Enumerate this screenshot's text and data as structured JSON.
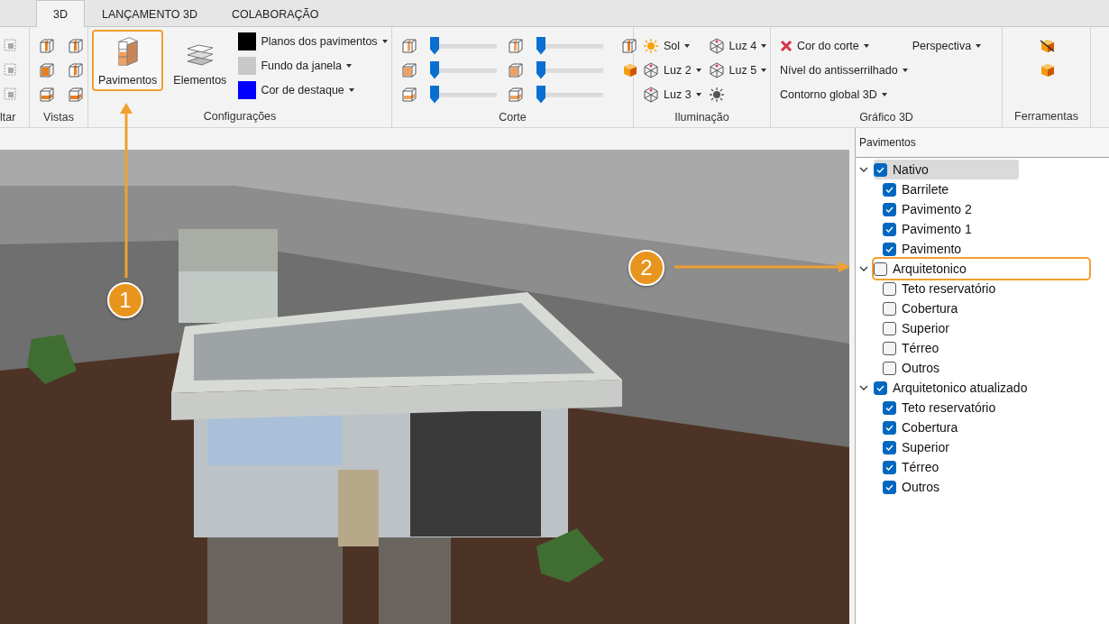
{
  "tabs": [
    {
      "label": "3D",
      "selected": true
    },
    {
      "label": "LANÇAMENTO 3D",
      "selected": false
    },
    {
      "label": "COLABORAÇÃO",
      "selected": false
    }
  ],
  "ribbon": {
    "groups": [
      {
        "kind": "filter",
        "label": "ltar"
      },
      {
        "kind": "views",
        "label": "Vistas"
      },
      {
        "kind": "config",
        "label": "Configurações",
        "big_buttons": [
          {
            "label": "Pavimentos",
            "highlighted": true
          },
          {
            "label": "Elementos",
            "highlighted": false
          }
        ],
        "color_items": [
          {
            "label": "Planos dos pavimentos",
            "color": "#000000"
          },
          {
            "label": "Fundo da janela",
            "color": "#c8c8c8"
          },
          {
            "label": "Cor de destaque",
            "color": "#0000ff"
          }
        ]
      },
      {
        "kind": "cut",
        "label": "Corte",
        "sliders": [
          {
            "level": 0
          },
          {
            "level": 0
          },
          {
            "level": 0
          },
          {
            "level": 0
          },
          {
            "level": 0
          },
          {
            "level": 0
          }
        ]
      },
      {
        "kind": "lights",
        "label": "Iluminação",
        "items": [
          {
            "kind": "sun",
            "label": "Sol"
          },
          {
            "kind": "light",
            "label": "Luz 4"
          },
          {
            "kind": "light",
            "label": "Luz 2"
          },
          {
            "kind": "light",
            "label": "Luz 5"
          },
          {
            "kind": "light",
            "label": "Luz 3"
          }
        ]
      },
      {
        "kind": "graphics",
        "label": "Gráfico 3D",
        "items": [
          {
            "kind": "icon",
            "label": "Cor do corte"
          },
          {
            "kind": "plain",
            "label": "Perspectiva"
          },
          {
            "kind": "wide",
            "label": "Nível do antisserrilhado"
          },
          {
            "kind": "wide",
            "label": "Contorno global 3D"
          }
        ]
      },
      {
        "kind": "tools",
        "label": "Ferramentas"
      }
    ]
  },
  "callouts": [
    {
      "number": "1"
    },
    {
      "number": "2"
    }
  ],
  "panel": {
    "title": "Pavimentos",
    "tree": [
      {
        "label": "Nativo",
        "checked": true,
        "expanded": true,
        "selected": true,
        "highlighted": false,
        "children": [
          {
            "label": "Barrilete",
            "checked": true,
            "selected": false
          },
          {
            "label": "Pavimento 2",
            "checked": true,
            "selected": false
          },
          {
            "label": "Pavimento 1",
            "checked": true,
            "selected": false
          },
          {
            "label": "Pavimento",
            "checked": true,
            "selected": false
          }
        ]
      },
      {
        "label": "Arquitetonico",
        "checked": false,
        "expanded": true,
        "selected": false,
        "highlighted": true,
        "children": [
          {
            "label": "Teto reservatório",
            "checked": false,
            "selected": false
          },
          {
            "label": "Cobertura",
            "checked": false,
            "selected": false
          },
          {
            "label": "Superior",
            "checked": false,
            "selected": false
          },
          {
            "label": "Térreo",
            "checked": false,
            "selected": false
          },
          {
            "label": "Outros",
            "checked": false,
            "selected": false
          }
        ]
      },
      {
        "label": "Arquitetonico atualizado",
        "checked": true,
        "expanded": true,
        "selected": false,
        "highlighted": false,
        "children": [
          {
            "label": "Teto reservatório",
            "checked": true,
            "selected": false
          },
          {
            "label": "Cobertura",
            "checked": true,
            "selected": false
          },
          {
            "label": "Superior",
            "checked": true,
            "selected": false
          },
          {
            "label": "Térreo",
            "checked": true,
            "selected": false
          },
          {
            "label": "Outros",
            "checked": true,
            "selected": false
          }
        ]
      }
    ]
  }
}
